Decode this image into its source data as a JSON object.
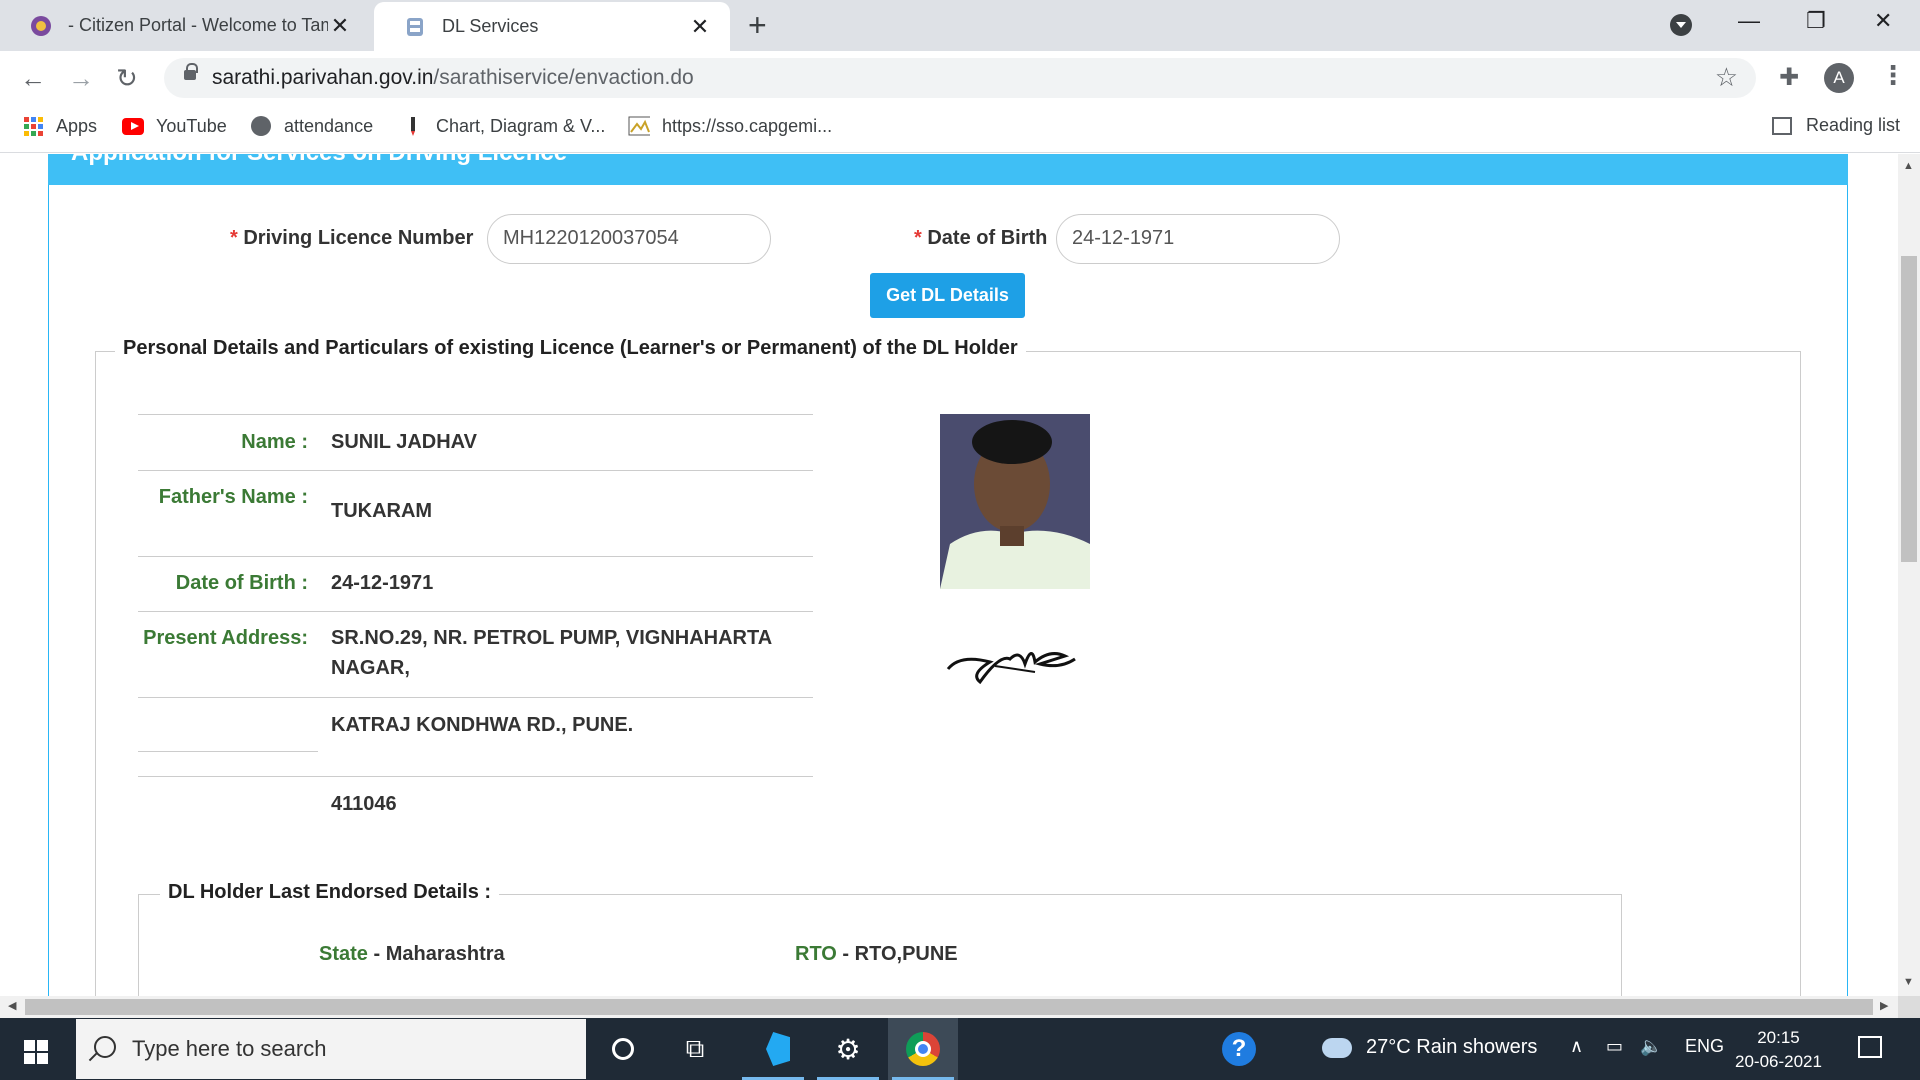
{
  "browser": {
    "tabs": [
      {
        "title": "- Citizen Portal - Welcome to Tamil Nadu Police",
        "active": false
      },
      {
        "title": "DL Services",
        "active": true
      }
    ],
    "url_host": "sarathi.parivahan.gov.in",
    "url_path": "/sarathiservice/envaction.do",
    "profile_initial": "A",
    "bookmarks": [
      {
        "label": "Apps",
        "icon": "apps-grid-icon"
      },
      {
        "label": "YouTube",
        "icon": "youtube-icon"
      },
      {
        "label": "attendance",
        "icon": "globe-icon"
      },
      {
        "label": "Chart, Diagram & V...",
        "icon": "pen-icon"
      },
      {
        "label": "https://sso.capgemi...",
        "icon": "image-icon"
      }
    ],
    "reading_list": "Reading list"
  },
  "page": {
    "banner_title": "Application for Services on Driving Licence",
    "form": {
      "dl_number_label": "Driving Licence Number",
      "dl_number_value": "MH1220120037054",
      "dob_label": "Date of Birth",
      "dob_value": "24-12-1971",
      "required_mark": "*",
      "submit_label": "Get DL Details"
    },
    "personal_section": {
      "legend": "Personal Details and Particulars of existing Licence (Learner's or Permanent) of the DL Holder",
      "name_label": "Name :",
      "name_value": "SUNIL JADHAV",
      "father_label": "Father's Name :",
      "father_value": "TUKARAM",
      "dob_label": "Date of Birth :",
      "dob_value": "24-12-1971",
      "address_label": "Present Address:",
      "address_line1": "SR.NO.29, NR. PETROL PUMP, VIGNHAHARTA NAGAR,",
      "address_line2": "KATRAJ KONDHWA RD., PUNE.",
      "address_pin": "411046"
    },
    "endorsed_section": {
      "legend": "DL Holder Last Endorsed Details :",
      "state_label": "State",
      "state_value": "Maharashtra",
      "rto_label": "RTO",
      "rto_value": "RTO,PUNE",
      "separator": "-"
    }
  },
  "taskbar": {
    "search_placeholder": "Type here to search",
    "weather": "27°C  Rain showers",
    "language": "ENG",
    "time": "20:15",
    "date": "20-06-2021"
  }
}
